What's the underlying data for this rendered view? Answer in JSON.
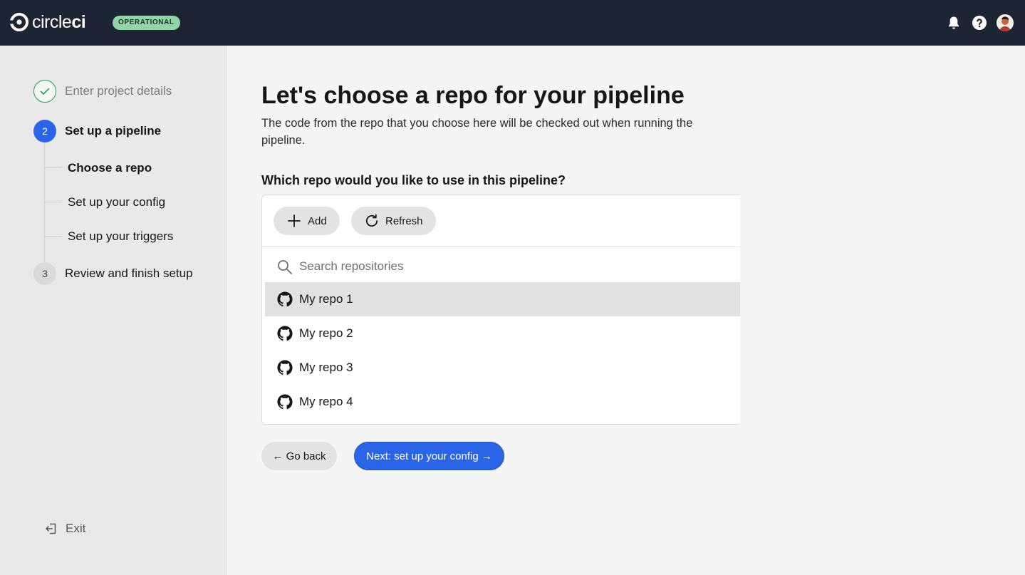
{
  "header": {
    "logo_text_light": "circle",
    "logo_text_bold": "ci",
    "status_badge": "OPERATIONAL",
    "icons": [
      "bell-icon",
      "help-icon",
      "avatar"
    ]
  },
  "stepper": {
    "steps": [
      {
        "label": "Enter project details",
        "state": "complete"
      },
      {
        "number": "2",
        "label": "Set up a pipeline",
        "state": "active"
      },
      {
        "number": "3",
        "label": "Review and finish setup",
        "state": "pending"
      }
    ],
    "substeps": [
      {
        "label": "Choose a repo",
        "active": true
      },
      {
        "label": "Set up your config",
        "active": false
      },
      {
        "label": "Set up your triggers",
        "active": false
      }
    ],
    "exit_label": "Exit"
  },
  "main": {
    "title": "Let's choose a repo for your pipeline",
    "description": "The code from the repo that you choose here will be checked out when running the pipeline.",
    "question": "Which repo would you like to use in this pipeline?",
    "add_label": "Add",
    "refresh_label": "Refresh",
    "search_placeholder": "Search repositories",
    "search_value": "",
    "repos": [
      {
        "name": "My repo 1",
        "selected": true
      },
      {
        "name": "My repo 2",
        "selected": false
      },
      {
        "name": "My repo 3",
        "selected": false
      },
      {
        "name": "My repo 4",
        "selected": false
      }
    ],
    "back_label": "← Go back",
    "next_label": "Next: set up your config →"
  },
  "colors": {
    "topbar": "#1d2433",
    "accent": "#2a65e8",
    "success": "#1f9e54",
    "badge": "#8fd5a6"
  }
}
